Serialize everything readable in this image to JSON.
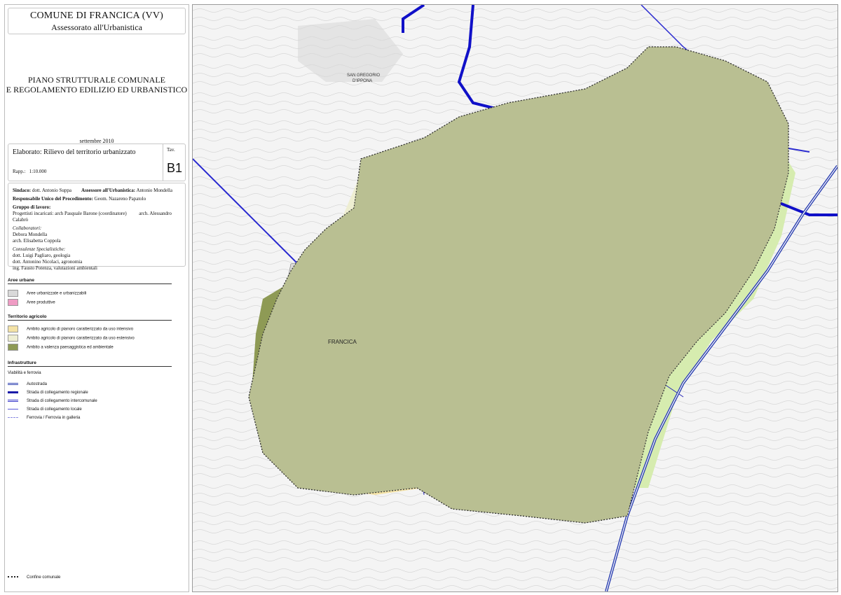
{
  "header": {
    "comune": "COMUNE DI FRANCICA (VV)",
    "assessorato": "Assessorato all'Urbanistica",
    "plan_line1": "PIANO STRUTTURALE COMUNALE",
    "plan_line2": "E REGOLAMENTO EDILIZIO ED URBANISTICO",
    "date": "settembre 2010"
  },
  "sheet": {
    "elaborato_label": "Elaborato:",
    "elaborato_title": "Rilievo del territorio urbanizzato",
    "rapp_label": "Rapp.:",
    "rapp_value": "1:10.000",
    "tav_label": "Tav.",
    "tav_value": "B1"
  },
  "credits": {
    "sindaco_label": "Sindaco:",
    "sindaco": "dott. Antonio Suppa",
    "assessore_label": "Assessore all'Urbanistica:",
    "assessore": "Antonio Mondella",
    "rup_label": "Responsabile Unico del Procedimento:",
    "rup": "Geom. Nazareno Papatolo",
    "gruppo_label": "Gruppo di lavoro:",
    "progettisti_label": "Progettisti incaricati:",
    "progettista1": "arch Pasquale Barone (coordinatore)",
    "progettista2": "arch. Alessandro Calabrò",
    "collaboratori_label": "Collaboratori:",
    "collaboratore1": "Debora Mondella",
    "collaboratore2": "arch. Elisabetta Coppola",
    "consulenze_label": "Consulenze Specialistiche:",
    "consulente1": "dott. Luigi Pagliaro, geologia",
    "consulente2": "dott. Antonino Nicolaci, agronomia",
    "consulente3": "ing. Fausto Potenza, valutazioni ambientali"
  },
  "legend": {
    "aree_urbane": {
      "title": "Aree urbane",
      "items": [
        {
          "label": "Aree urbanizzate e urbanizzabili",
          "color": "#d9d9d9"
        },
        {
          "label": "Aree produttive",
          "color": "#ef9cc4"
        }
      ]
    },
    "territorio_agricolo": {
      "title": "Territorio agricolo",
      "items": [
        {
          "label": "Ambito agricolo di pianoro caratterizzato da uso intensivo",
          "color": "#f3e2a6"
        },
        {
          "label": "Ambito agricolo di pianoro caratterizzato da uso estensivo",
          "color": "#eeeed2"
        },
        {
          "label": "Ambito a valenza paesaggistica ed ambientale",
          "color": "#8e9a55"
        }
      ]
    },
    "infrastrutture": {
      "title": "Infrastrutture",
      "subtitle": "Viabilità e ferrovia",
      "items": [
        {
          "label": "Autostrada",
          "color": "#2b3fb0"
        },
        {
          "label": "Strada di collegamento regionale",
          "color": "#1a1aa8"
        },
        {
          "label": "Strada di collegamento intercomunale",
          "color": "#3a3acb"
        },
        {
          "label": "Strada di collegamento locale",
          "color": "#5a5ad8"
        },
        {
          "label": "Ferrovia / Ferrovia in galleria",
          "color": "#8a8ae0"
        }
      ]
    },
    "confine": {
      "label": "Confine comunale"
    }
  },
  "map": {
    "place_labels": {
      "francica": "FRANCICA",
      "san_gregorio": "SAN GREGORIO",
      "ippona": "D'IPPONA"
    },
    "colors": {
      "urban": "#d9d9d9",
      "productive": "#ef9cc4",
      "intensive": "#f3e2a6",
      "extensive": "#eeeed2",
      "landscape": "#b4b98d",
      "landscape_dark": "#8e9a55",
      "highway_buffer": "#d6ecaf",
      "road": "#1f1fb4",
      "regional_road": "#1010c8",
      "outside": "#f3f3f3"
    }
  }
}
